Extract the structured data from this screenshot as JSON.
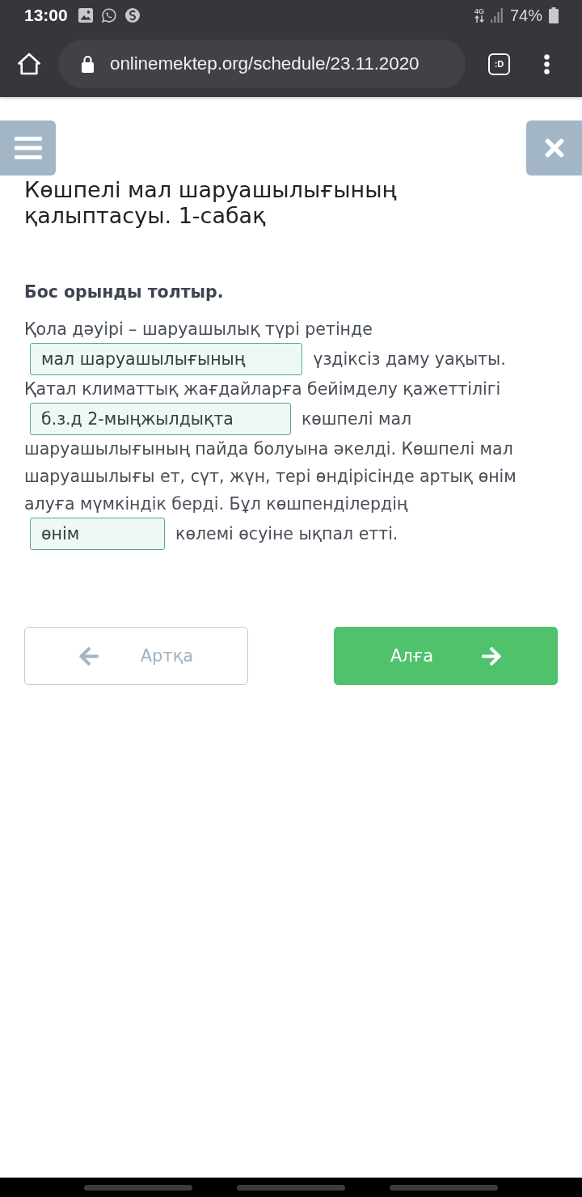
{
  "status_bar": {
    "time": "13:00",
    "network": "4G",
    "battery": "74%"
  },
  "browser": {
    "url": "onlinemektep.org/schedule/23.11.2020",
    "tab_count": ":D"
  },
  "lesson": {
    "title": "Көшпелі мал шаруашылығының қалыптасуы. 1-сабақ"
  },
  "task": {
    "instruction": "Бос орынды толтыр.",
    "lines": [
      {
        "parts": [
          {
            "kind": "text",
            "text": "Қола дәуірі – шаруашылық түрі ретінде"
          }
        ]
      },
      {
        "parts": [
          {
            "kind": "blank",
            "value": "мал шаруашылығының"
          },
          {
            "kind": "text",
            "text": "үздіксіз даму уақыты."
          }
        ]
      },
      {
        "parts": [
          {
            "kind": "text",
            "text": "Қатал климаттық жағдайларға бейімделу қажеттілігі"
          }
        ]
      },
      {
        "parts": [
          {
            "kind": "blank",
            "value": "б.з.д 2-мыңжылдықта"
          },
          {
            "kind": "text",
            "text": "көшпелі мал"
          }
        ]
      },
      {
        "parts": [
          {
            "kind": "text",
            "text": "шаруашылығының пайда болуына әкелді. Көшпелі мал"
          }
        ]
      },
      {
        "parts": [
          {
            "kind": "text",
            "text": "шаруашылығы ет, сүт, жүн, тері өндірісінде артық өнім"
          }
        ]
      },
      {
        "parts": [
          {
            "kind": "text",
            "text": "алуға мүмкіндік берді. Бұл көшпенділердің"
          }
        ]
      },
      {
        "parts": [
          {
            "kind": "blank",
            "value": "өнім"
          },
          {
            "kind": "text",
            "text": "көлемі өсуіне ықпал етті."
          }
        ]
      }
    ]
  },
  "navigation": {
    "back": "Артқа",
    "next": "Алға"
  }
}
